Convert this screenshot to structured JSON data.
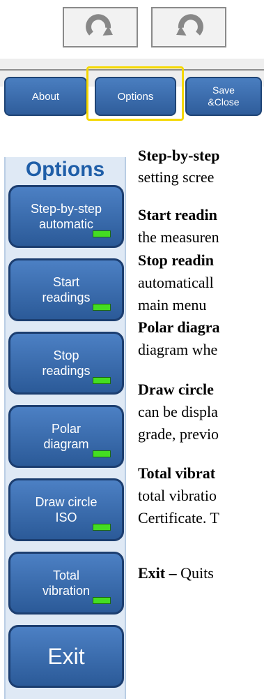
{
  "toolbar": {
    "redo_icon": "redo-icon",
    "undo_icon": "undo-icon"
  },
  "tabs": {
    "about": "About",
    "options": "Options",
    "save_close": "Save\n&Close"
  },
  "panel": {
    "title": "Options",
    "buttons": [
      {
        "line1": "Step-by-step",
        "line2": "automatic"
      },
      {
        "line1": "Start",
        "line2": "readings"
      },
      {
        "line1": "Stop",
        "line2": "readings"
      },
      {
        "line1": "Polar",
        "line2": "diagram"
      },
      {
        "line1": "Draw circle",
        "line2": "ISO"
      },
      {
        "line1": "Total",
        "line2": "vibration"
      }
    ],
    "exit": "Exit"
  },
  "description": {
    "lines": [
      {
        "bold": "Step-by-step",
        "text": ""
      },
      {
        "bold": "",
        "text": "setting scree"
      },
      {
        "bold": "Start readin",
        "text": ""
      },
      {
        "bold": "",
        "text": "the measuren"
      },
      {
        "bold": "Stop readin",
        "text": ""
      },
      {
        "bold": "",
        "text": "automaticall"
      },
      {
        "bold": "",
        "text": "main menu"
      },
      {
        "bold": "Polar diagra",
        "text": ""
      },
      {
        "bold": "",
        "text": "diagram whe"
      },
      {
        "bold": "Draw circle",
        "text": ""
      },
      {
        "bold": "",
        "text": "can be displa"
      },
      {
        "bold": "",
        "text": "grade, previo"
      },
      {
        "bold": "Total vibrat",
        "text": ""
      },
      {
        "bold": "",
        "text": "total vibratio"
      },
      {
        "bold": "",
        "text": "Certificate. T"
      },
      {
        "bold": "Exit – ",
        "text": "Quits"
      }
    ]
  },
  "colors": {
    "button_blue": "#2f5d9b",
    "highlight": "#f5d800",
    "indicator_green": "#44dd22",
    "panel_title": "#1f5ea8"
  }
}
